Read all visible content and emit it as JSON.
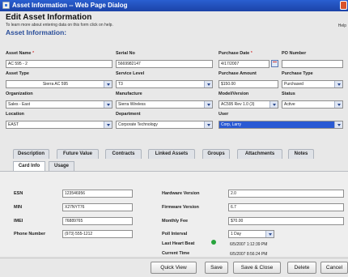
{
  "window": {
    "title": "Asset Information -- Web Page Dialog"
  },
  "header": {
    "title": "Edit Asset Information",
    "subtitle": "To learn more about entering data on this form click on help.",
    "help_link": "Help",
    "section_title": "Asset Information:"
  },
  "form": {
    "asset_name": {
      "label": "Asset Name",
      "required_mark": "*",
      "value": "AC 595 - 2"
    },
    "serial_no": {
      "label": "Serial No",
      "value": "5669982147"
    },
    "purchase_date": {
      "label": "Purchase Date",
      "required_mark": "*",
      "value": "4/17/2007"
    },
    "po_number": {
      "label": "PO Number",
      "value": ""
    },
    "asset_type": {
      "label": "Asset Type",
      "value": "Sierra AC 595"
    },
    "service_level": {
      "label": "Service Level",
      "value": "T3"
    },
    "purchase_amount": {
      "label": "Purchase Amount",
      "value": "$150.00"
    },
    "purchase_type": {
      "label": "Purchase Type",
      "value": "Purchased"
    },
    "organization": {
      "label": "Organization",
      "value": "Sales - East"
    },
    "manufacturer": {
      "label": "Manufacture",
      "value": "Sierra Wireless"
    },
    "model_version": {
      "label": "Model/Version",
      "value": "AC595 Rev 1.0 (3)"
    },
    "status": {
      "label": "Status",
      "value": "Active"
    },
    "location": {
      "label": "Location",
      "value": "EAST"
    },
    "department": {
      "label": "Department",
      "value": "Corporate Technology"
    },
    "user": {
      "label": "User",
      "value": "Corp, Larry"
    }
  },
  "tabs": [
    "Description",
    "Future Value",
    "Contracts",
    "Linked Assets",
    "Groups",
    "Attachments",
    "Notes"
  ],
  "subtabs": [
    "Card Info",
    "Usage"
  ],
  "card_info": {
    "esn": {
      "label": "ESN",
      "value": "123546956"
    },
    "min": {
      "label": "MIN",
      "value": "X27NYT76"
    },
    "imei": {
      "label": "IMEI",
      "value": "76889765"
    },
    "phone_number": {
      "label": "Phone Number",
      "value": "(973) 555-1212"
    },
    "hardware_version": {
      "label": "Hardware Version",
      "value": "2.0"
    },
    "firmware_version": {
      "label": "Firmware Version",
      "value": "6.7"
    },
    "monthly_fee": {
      "label": "Monthly Fee",
      "value": "$70.00"
    },
    "poll_interval": {
      "label": "Poll Interval",
      "value": "1 Day"
    },
    "last_heart_beat": {
      "label": "Last Heart Beat",
      "value": "6/5/2007 1:12:39 PM",
      "status_color": "#27a43c"
    },
    "current_time": {
      "label": "Current Time",
      "value": "6/5/2007 8:56:24 PM"
    }
  },
  "buttons": {
    "quick_view": "Quick View",
    "save": "Save",
    "save_close": "Save & Close",
    "delete": "Delete",
    "cancel": "Cancel"
  },
  "colors": {
    "title_bar": "#1c43a8",
    "section_title": "#2a4e9a",
    "selected_user": "#2a5ad4"
  }
}
